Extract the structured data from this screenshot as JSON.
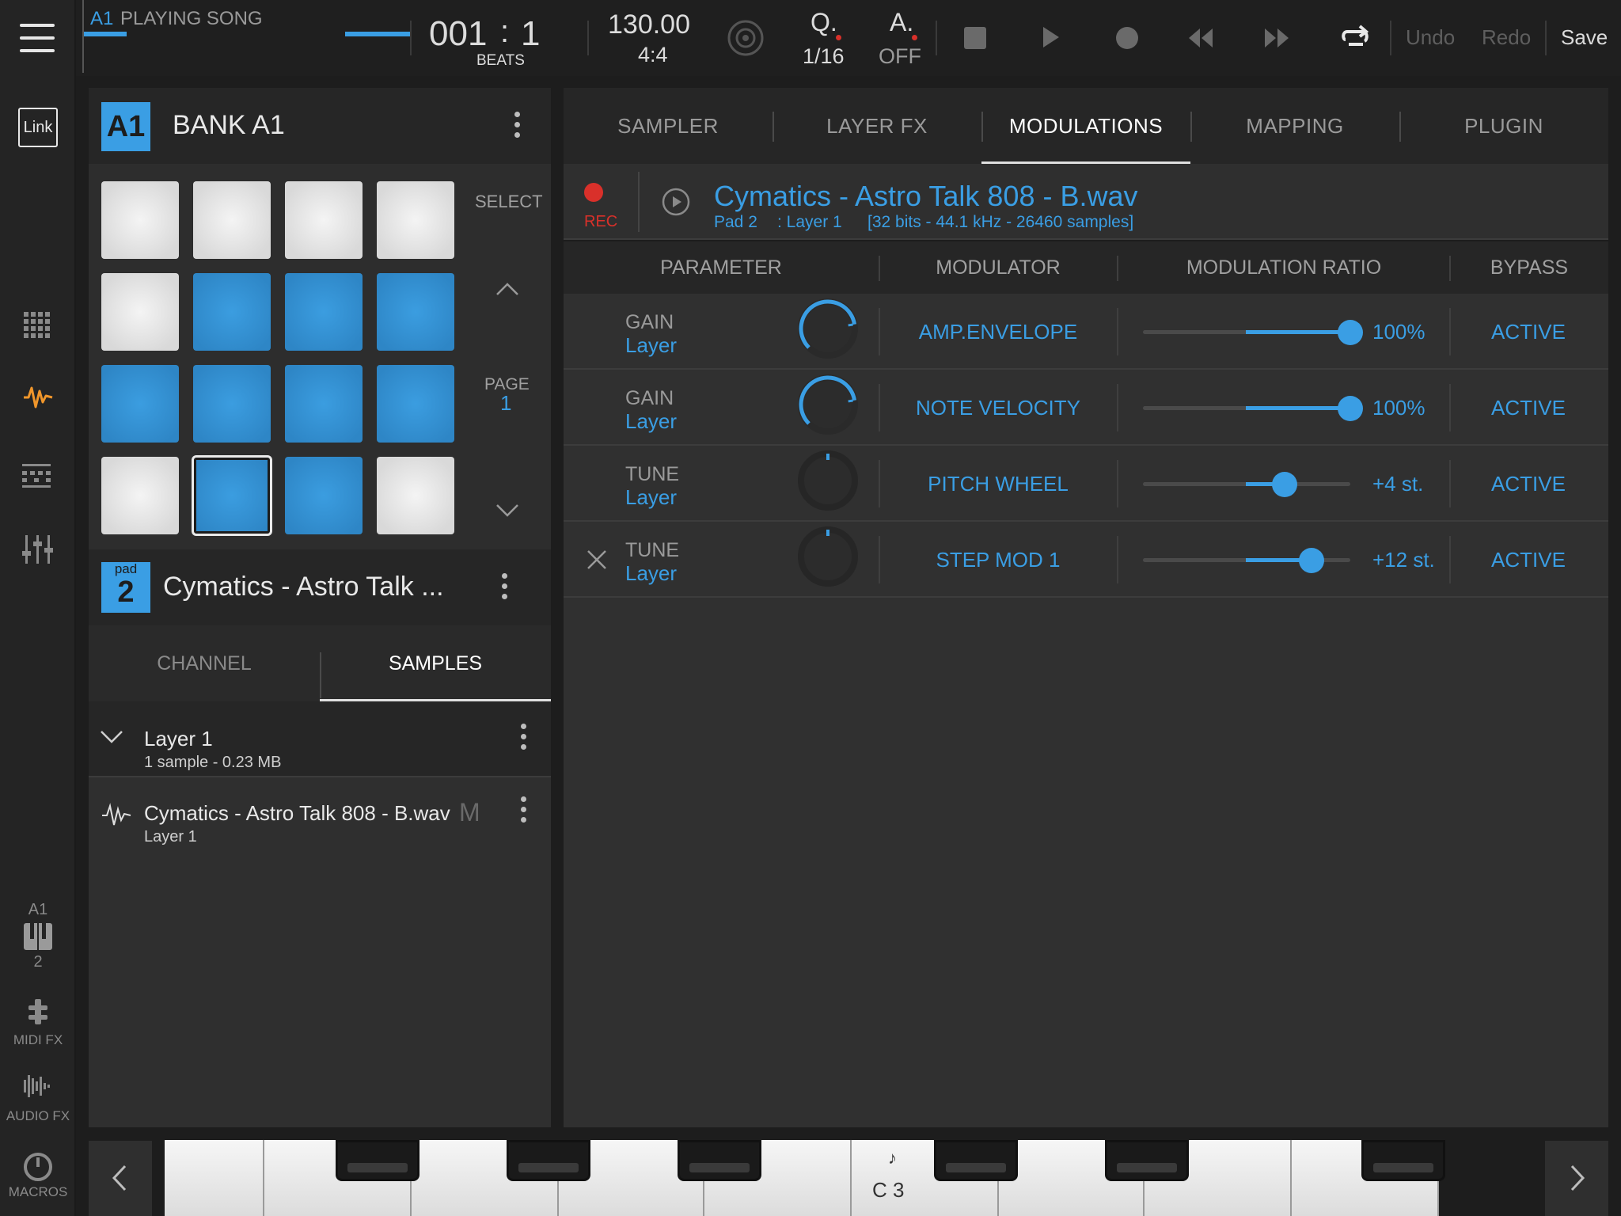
{
  "colors": {
    "accent": "#3a9ee4",
    "rec": "#d9302a",
    "pad_white": "#e8e8e8",
    "pad_blue": "#3393d6"
  },
  "topbar": {
    "slot": "A1",
    "status": "PLAYING SONG",
    "position_bar": "001",
    "position_beat": "1",
    "position_sep": ":",
    "position_unit": "BEATS",
    "tempo": "130.00",
    "signature": "4:4",
    "quantize_label": "Q.",
    "quantize_value": "1/16",
    "auto_label": "A.",
    "auto_value": "OFF",
    "undo": "Undo",
    "redo": "Redo",
    "save": "Save"
  },
  "sidebar": {
    "link": "Link",
    "instrument_slot": "A1",
    "instrument_num": "2",
    "midi_fx": "MIDI FX",
    "audio_fx": "AUDIO FX",
    "macros": "MACROS"
  },
  "bank": {
    "badge": "A1",
    "title": "BANK A1",
    "select": "SELECT",
    "page_label": "PAGE",
    "page_num": "1"
  },
  "pads": [
    {
      "color": "white"
    },
    {
      "color": "white"
    },
    {
      "color": "white"
    },
    {
      "color": "white"
    },
    {
      "color": "white"
    },
    {
      "color": "blue"
    },
    {
      "color": "blue"
    },
    {
      "color": "blue"
    },
    {
      "color": "blue"
    },
    {
      "color": "blue"
    },
    {
      "color": "blue"
    },
    {
      "color": "blue"
    },
    {
      "color": "white"
    },
    {
      "color": "blue",
      "selected": true
    },
    {
      "color": "blue"
    },
    {
      "color": "white"
    }
  ],
  "pad": {
    "label": "pad",
    "num": "2",
    "name": "Cymatics - Astro Talk ..."
  },
  "subtabs": [
    "CHANNEL",
    "SAMPLES"
  ],
  "layers": {
    "layer_name": "Layer 1",
    "layer_info": "1 sample - 0.23 MB",
    "sample_name": "Cymatics - Astro Talk 808 - B.wav",
    "sample_layer": "Layer 1",
    "mono": "M"
  },
  "right_tabs": [
    "SAMPLER",
    "LAYER FX",
    "MODULATIONS",
    "MAPPING",
    "PLUGIN"
  ],
  "active_tab": "MODULATIONS",
  "sample": {
    "rec": "REC",
    "title": "Cymatics - Astro Talk 808 - B.wav",
    "pad": "Pad 2",
    "layer": ": Layer 1",
    "format": "[32 bits - 44.1 kHz - 26460 samples]"
  },
  "modulations": {
    "headers": [
      "PARAMETER",
      "MODULATOR",
      "MODULATION RATIO",
      "BYPASS"
    ],
    "rows": [
      {
        "param": "GAIN",
        "target": "Layer",
        "modulator": "AMP.ENVELOPE",
        "ratio_text": "100%",
        "ratio": 1.0,
        "bypass": "ACTIVE",
        "knob_level": 0.8
      },
      {
        "param": "GAIN",
        "target": "Layer",
        "modulator": "NOTE VELOCITY",
        "ratio_text": "100%",
        "ratio": 1.0,
        "bypass": "ACTIVE",
        "knob_level": 0.8
      },
      {
        "param": "TUNE",
        "target": "Layer",
        "modulator": "PITCH WHEEL",
        "ratio_text": "+4 st.",
        "ratio": 0.25,
        "bypass": "ACTIVE",
        "knob_level": 0.5
      },
      {
        "param": "TUNE",
        "target": "Layer",
        "modulator": "STEP MOD 1",
        "ratio_text": "+12 st.",
        "ratio": 0.42,
        "bypass": "ACTIVE",
        "knob_level": 0.5,
        "removable": true
      }
    ]
  },
  "keyboard": {
    "note_label": "C 3",
    "note_icon": "♪"
  }
}
